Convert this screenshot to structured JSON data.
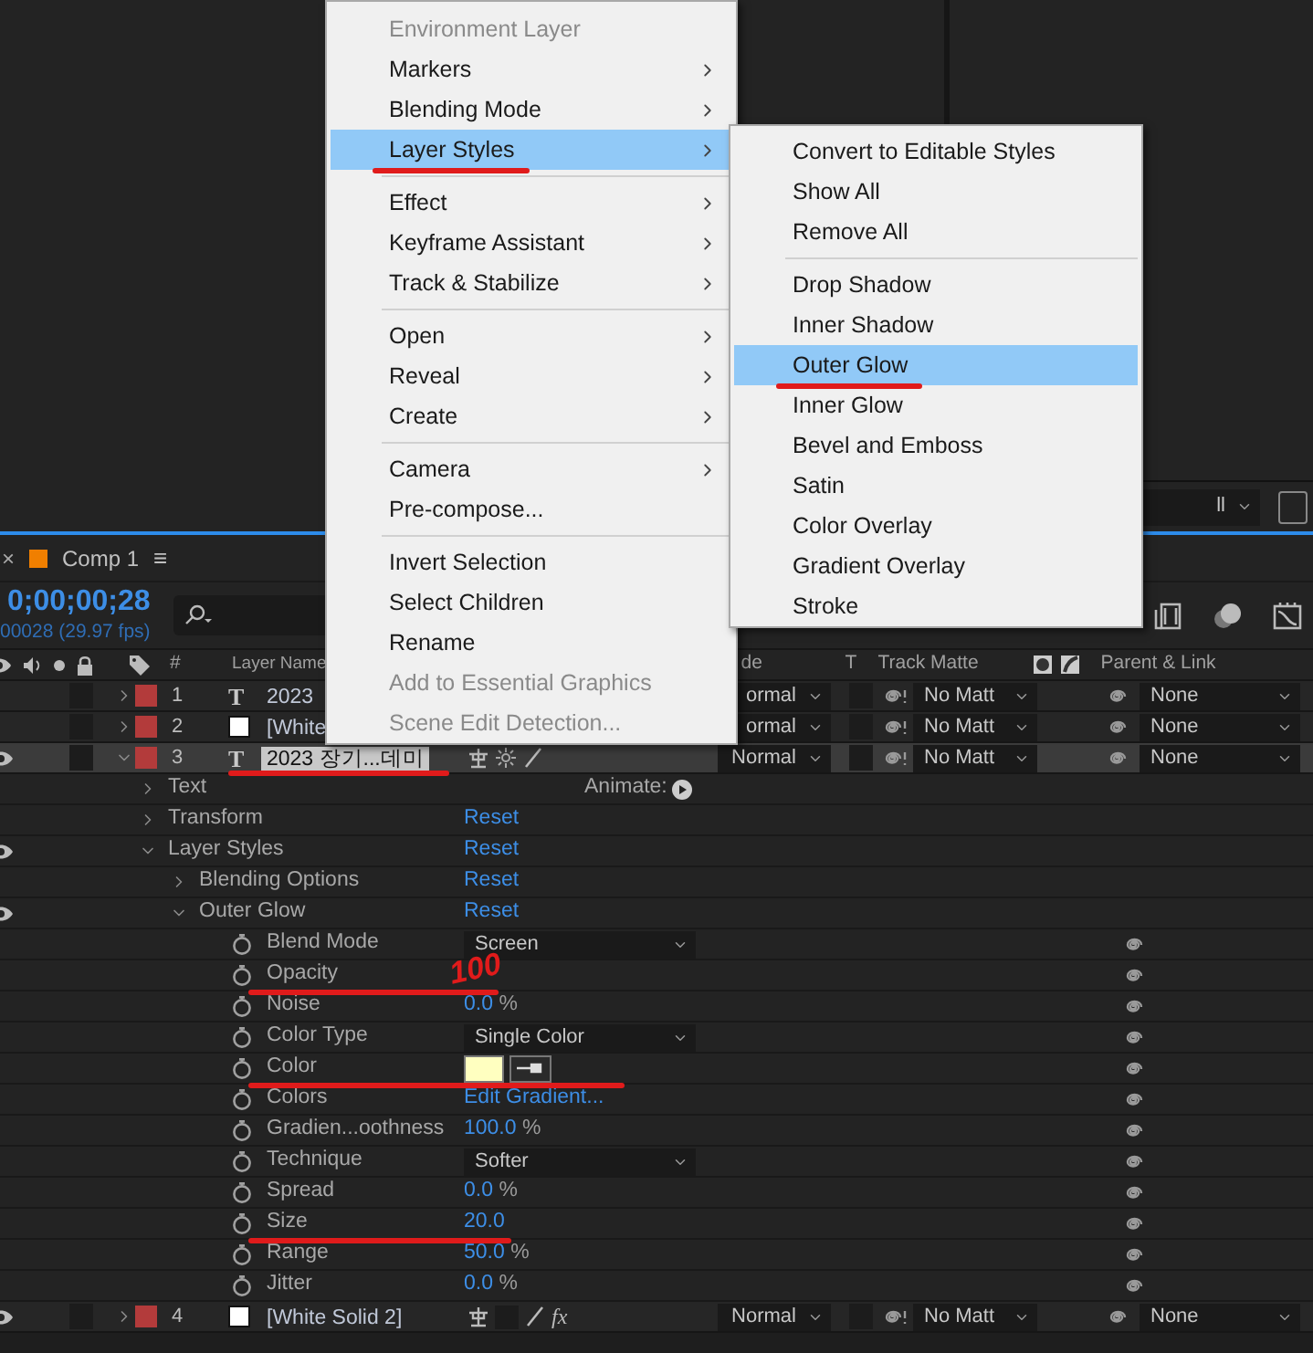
{
  "viewer": {
    "resolution_dropdown": "ll"
  },
  "context_menu": {
    "items": [
      {
        "kind": "item",
        "label": "Environment Layer",
        "disabled": true,
        "submenu": false,
        "selected": false,
        "underlined": false
      },
      {
        "kind": "item",
        "label": "Markers",
        "disabled": false,
        "submenu": true,
        "selected": false,
        "underlined": false
      },
      {
        "kind": "item",
        "label": "Blending Mode",
        "disabled": false,
        "submenu": true,
        "selected": false,
        "underlined": false
      },
      {
        "kind": "item",
        "label": "Layer Styles",
        "disabled": false,
        "submenu": true,
        "selected": true,
        "underlined": true
      },
      {
        "kind": "separator"
      },
      {
        "kind": "item",
        "label": "Effect",
        "disabled": false,
        "submenu": true,
        "selected": false,
        "underlined": false
      },
      {
        "kind": "item",
        "label": "Keyframe Assistant",
        "disabled": false,
        "submenu": true,
        "selected": false,
        "underlined": false
      },
      {
        "kind": "item",
        "label": "Track & Stabilize",
        "disabled": false,
        "submenu": true,
        "selected": false,
        "underlined": false
      },
      {
        "kind": "separator"
      },
      {
        "kind": "item",
        "label": "Open",
        "disabled": false,
        "submenu": true,
        "selected": false,
        "underlined": false
      },
      {
        "kind": "item",
        "label": "Reveal",
        "disabled": false,
        "submenu": true,
        "selected": false,
        "underlined": false
      },
      {
        "kind": "item",
        "label": "Create",
        "disabled": false,
        "submenu": true,
        "selected": false,
        "underlined": false
      },
      {
        "kind": "separator"
      },
      {
        "kind": "item",
        "label": "Camera",
        "disabled": false,
        "submenu": true,
        "selected": false,
        "underlined": false
      },
      {
        "kind": "item",
        "label": "Pre-compose...",
        "disabled": false,
        "submenu": false,
        "selected": false,
        "underlined": false
      },
      {
        "kind": "separator"
      },
      {
        "kind": "item",
        "label": "Invert Selection",
        "disabled": false,
        "submenu": false,
        "selected": false,
        "underlined": false
      },
      {
        "kind": "item",
        "label": "Select Children",
        "disabled": false,
        "submenu": false,
        "selected": false,
        "underlined": false
      },
      {
        "kind": "item",
        "label": "Rename",
        "disabled": false,
        "submenu": false,
        "selected": false,
        "underlined": false
      },
      {
        "kind": "item",
        "label": "Add to Essential Graphics",
        "disabled": true,
        "submenu": false,
        "selected": false,
        "underlined": false
      },
      {
        "kind": "item",
        "label": "Scene Edit Detection...",
        "disabled": true,
        "submenu": false,
        "selected": false,
        "underlined": false
      }
    ]
  },
  "submenu": {
    "items": [
      {
        "kind": "item",
        "label": "Convert to Editable Styles",
        "disabled": false,
        "submenu": false,
        "selected": false,
        "underlined": false
      },
      {
        "kind": "item",
        "label": "Show All",
        "disabled": false,
        "submenu": false,
        "selected": false,
        "underlined": false
      },
      {
        "kind": "item",
        "label": "Remove All",
        "disabled": false,
        "submenu": false,
        "selected": false,
        "underlined": false
      },
      {
        "kind": "separator"
      },
      {
        "kind": "item",
        "label": "Drop Shadow",
        "disabled": false,
        "submenu": false,
        "selected": false,
        "underlined": false
      },
      {
        "kind": "item",
        "label": "Inner Shadow",
        "disabled": false,
        "submenu": false,
        "selected": false,
        "underlined": false
      },
      {
        "kind": "item",
        "label": "Outer Glow",
        "disabled": false,
        "submenu": false,
        "selected": true,
        "underlined": true
      },
      {
        "kind": "item",
        "label": "Inner Glow",
        "disabled": false,
        "submenu": false,
        "selected": false,
        "underlined": false
      },
      {
        "kind": "item",
        "label": "Bevel and Emboss",
        "disabled": false,
        "submenu": false,
        "selected": false,
        "underlined": false
      },
      {
        "kind": "item",
        "label": "Satin",
        "disabled": false,
        "submenu": false,
        "selected": false,
        "underlined": false
      },
      {
        "kind": "item",
        "label": "Color Overlay",
        "disabled": false,
        "submenu": false,
        "selected": false,
        "underlined": false
      },
      {
        "kind": "item",
        "label": "Gradient Overlay",
        "disabled": false,
        "submenu": false,
        "selected": false,
        "underlined": false
      },
      {
        "kind": "item",
        "label": "Stroke",
        "disabled": false,
        "submenu": false,
        "selected": false,
        "underlined": false
      }
    ]
  },
  "timeline": {
    "tab": {
      "close": "×",
      "title": "Comp 1",
      "menu": "≡",
      "color": "#f07f00"
    },
    "current_time": "0;00;00;28",
    "frame_info": "00028 (29.97 fps)",
    "columns": {
      "number": "#",
      "layer_name": "Layer Name",
      "mode": "de",
      "t": "T",
      "track_matte": "Track Matte",
      "parent": "Parent & Link"
    },
    "layers": [
      {
        "kind": "text",
        "type_glyph": "T",
        "number": "1",
        "name": "2023",
        "color": "#b33b3b",
        "visible": false,
        "expanded": false,
        "selected": false,
        "editing": false,
        "underlined": false,
        "mode": "ormal",
        "track_matte": "No Matt",
        "parent": "None"
      },
      {
        "kind": "solid",
        "number": "2",
        "name": "[White",
        "color": "#b33b3b",
        "visible": false,
        "expanded": false,
        "selected": false,
        "editing": false,
        "underlined": false,
        "mode": "ormal",
        "track_matte": "No Matt",
        "parent": "None"
      },
      {
        "kind": "text",
        "type_glyph": "T",
        "number": "3",
        "name": "2023 장기...데미",
        "color": "#b33b3b",
        "visible": true,
        "expanded": true,
        "selected": true,
        "editing": true,
        "underlined": true,
        "mode": "Normal",
        "track_matte": "No Matt",
        "parent": "None",
        "switches": [
          {
            "kind": "shy"
          },
          {
            "kind": "collapse"
          },
          {
            "kind": "quality"
          }
        ],
        "properties": [
          {
            "kind": "group",
            "name": "Text",
            "expanded": false,
            "visible": false,
            "animate": "Animate:"
          },
          {
            "kind": "group",
            "name": "Transform",
            "expanded": false,
            "visible": false,
            "reset": "Reset"
          },
          {
            "kind": "group",
            "name": "Layer Styles",
            "expanded": true,
            "visible": true,
            "reset": "Reset",
            "children": [
              {
                "kind": "group",
                "name": "Blending Options",
                "expanded": false,
                "visible": false,
                "reset": "Reset"
              },
              {
                "kind": "group",
                "name": "Outer Glow",
                "expanded": true,
                "visible": true,
                "reset": "Reset",
                "children": [
                  {
                    "kind": "dropdown",
                    "name": "Blend Mode",
                    "value": "Screen",
                    "underlined": false
                  },
                  {
                    "kind": "annotated",
                    "name": "Opacity",
                    "handwritten": "100",
                    "underlined": true
                  },
                  {
                    "kind": "number",
                    "name": "Noise",
                    "value": "0.0",
                    "unit": "%",
                    "underlined": false
                  },
                  {
                    "kind": "dropdown",
                    "name": "Color Type",
                    "value": "Single Color",
                    "underlined": false
                  },
                  {
                    "kind": "color",
                    "name": "Color",
                    "color": "#ffffc0",
                    "underlined": true
                  },
                  {
                    "kind": "link",
                    "name": "Colors",
                    "value": "Edit Gradient...",
                    "underlined": false
                  },
                  {
                    "kind": "number",
                    "name": "Gradien...oothness",
                    "value": "100.0",
                    "unit": "%",
                    "underlined": false
                  },
                  {
                    "kind": "dropdown",
                    "name": "Technique",
                    "value": "Softer",
                    "underlined": false
                  },
                  {
                    "kind": "number",
                    "name": "Spread",
                    "value": "0.0",
                    "unit": "%",
                    "underlined": false
                  },
                  {
                    "kind": "number",
                    "name": "Size",
                    "value": "20.0",
                    "underlined": true
                  },
                  {
                    "kind": "number",
                    "name": "Range",
                    "value": "50.0",
                    "unit": "%",
                    "underlined": false
                  },
                  {
                    "kind": "number",
                    "name": "Jitter",
                    "value": "0.0",
                    "unit": "%",
                    "underlined": false
                  }
                ]
              }
            ]
          }
        ]
      },
      {
        "kind": "solid",
        "number": "4",
        "name": "[White Solid 2]",
        "color": "#b33b3b",
        "visible": true,
        "expanded": false,
        "selected": false,
        "editing": false,
        "underlined": false,
        "mode": "Normal",
        "track_matte": "No Matt",
        "parent": "None",
        "effects": "fx",
        "switches": [
          {
            "kind": "shy"
          },
          {
            "kind": "blank"
          },
          {
            "kind": "quality"
          }
        ]
      }
    ]
  }
}
